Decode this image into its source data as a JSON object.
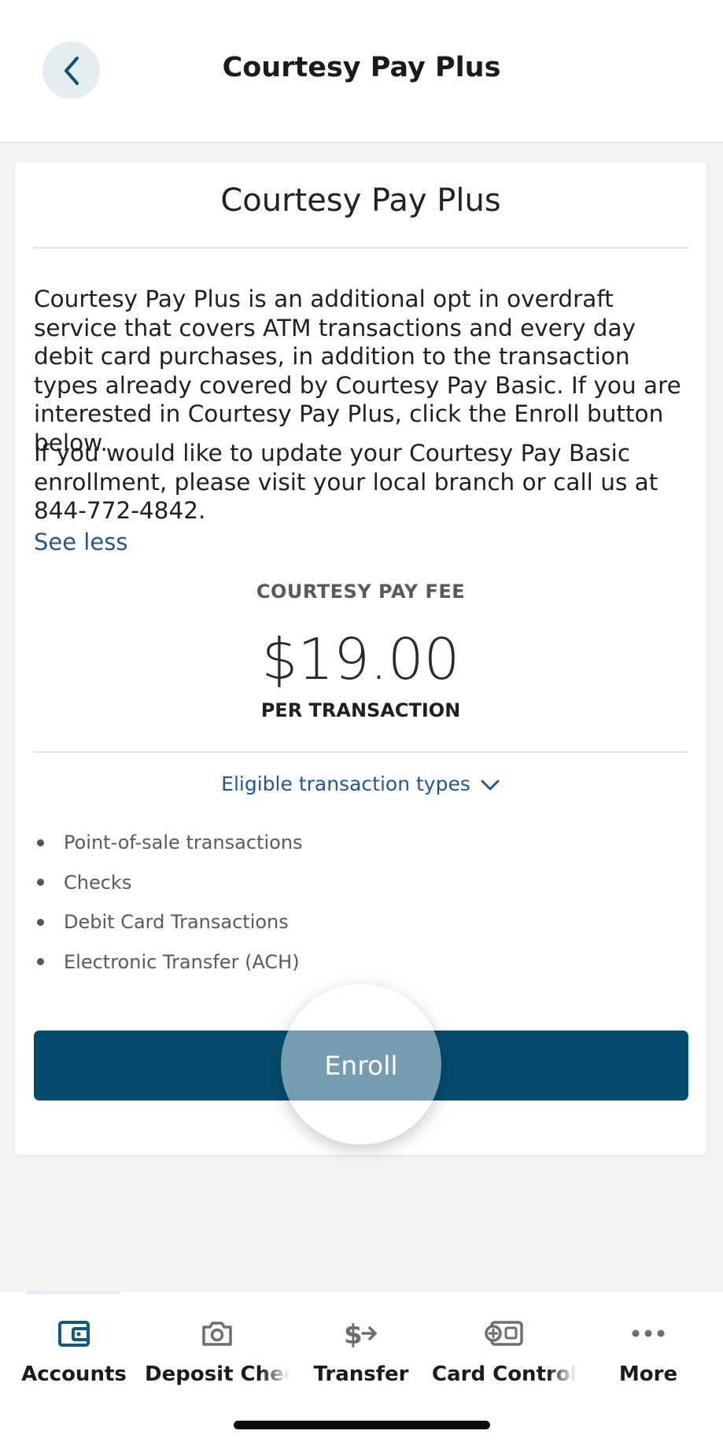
{
  "header": {
    "title": "Courtesy Pay Plus"
  },
  "card": {
    "title": "Courtesy Pay Plus",
    "paragraph1": "Courtesy Pay Plus is an additional opt in overdraft service that covers ATM transactions and every day debit card purchases, in addition to the transaction types already covered by Courtesy Pay Basic. If you are interested in Courtesy Pay Plus, click the Enroll button below.",
    "paragraph2": "If you would like to update your Courtesy Pay Basic enrollment, please visit your local branch or call us at 844-772-4842.",
    "see_less": "See less",
    "fee_label": "COURTESY PAY FEE",
    "fee_amount": "$19.00",
    "fee_unit": "PER TRANSACTION",
    "eligible_label": "Eligible transaction types",
    "transaction_types": [
      "Point-of-sale transactions",
      "Checks",
      "Debit Card Transactions",
      "Electronic Transfer (ACH)"
    ],
    "enroll_label": "Enroll"
  },
  "tabs": [
    {
      "label": "Accounts",
      "icon": "wallet-icon"
    },
    {
      "label": "Deposit Chec",
      "icon": "camera-icon"
    },
    {
      "label": "Transfer",
      "icon": "transfer-icon"
    },
    {
      "label": "Card Control",
      "icon": "card-control-icon"
    },
    {
      "label": "More",
      "icon": "more-icon"
    }
  ],
  "colors": {
    "primary": "#044d6e",
    "link": "#23578f",
    "tab_active_icon": "#0f5a7e",
    "tab_icon": "#6e6e6e"
  }
}
